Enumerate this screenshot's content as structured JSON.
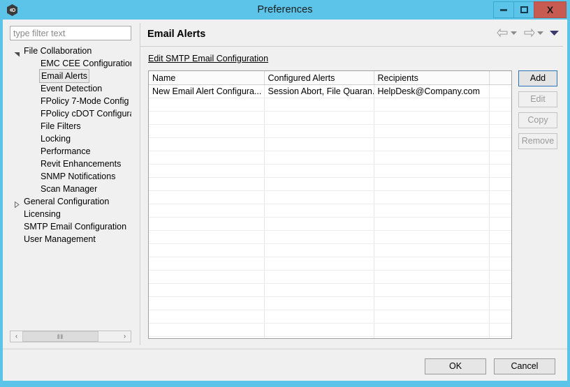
{
  "window": {
    "title": "Preferences",
    "app_icon": "app-hexagon-icon",
    "controls": {
      "minimize": "minimize-icon",
      "maximize": "maximize-icon",
      "close": "X"
    }
  },
  "sidebar": {
    "filter_placeholder": "type filter text",
    "items": [
      {
        "label": "File Collaboration",
        "level": 0,
        "state": "expanded",
        "selected": false
      },
      {
        "label": "EMC CEE Configuration",
        "level": 1,
        "state": "leaf",
        "selected": false
      },
      {
        "label": "Email Alerts",
        "level": 1,
        "state": "leaf",
        "selected": true
      },
      {
        "label": "Event Detection",
        "level": 1,
        "state": "leaf",
        "selected": false
      },
      {
        "label": "FPolicy 7-Mode Config",
        "level": 1,
        "state": "leaf",
        "selected": false
      },
      {
        "label": "FPolicy cDOT Configura",
        "level": 1,
        "state": "leaf",
        "selected": false
      },
      {
        "label": "File Filters",
        "level": 1,
        "state": "leaf",
        "selected": false
      },
      {
        "label": "Locking",
        "level": 1,
        "state": "leaf",
        "selected": false
      },
      {
        "label": "Performance",
        "level": 1,
        "state": "leaf",
        "selected": false
      },
      {
        "label": "Revit Enhancements",
        "level": 1,
        "state": "leaf",
        "selected": false
      },
      {
        "label": "SNMP Notifications",
        "level": 1,
        "state": "leaf",
        "selected": false
      },
      {
        "label": "Scan Manager",
        "level": 1,
        "state": "leaf",
        "selected": false
      },
      {
        "label": "General Configuration",
        "level": 0,
        "state": "collapsed",
        "selected": false
      },
      {
        "label": "Licensing",
        "level": 0,
        "state": "leaf",
        "selected": false
      },
      {
        "label": "SMTP Email Configuration",
        "level": 0,
        "state": "leaf",
        "selected": false
      },
      {
        "label": "User Management",
        "level": 0,
        "state": "leaf",
        "selected": false
      }
    ],
    "scrollbar": {
      "left_arrow": "‹",
      "right_arrow": "›",
      "thumb_grip": "‖‖"
    }
  },
  "content": {
    "title": "Email Alerts",
    "link": "Edit SMTP Email Configuration",
    "nav": {
      "back_icon": "back-arrow-icon",
      "back_menu_icon": "chevron-down-icon",
      "forward_icon": "forward-arrow-icon",
      "forward_menu_icon": "chevron-down-icon",
      "more_icon": "chevron-down-filled-icon"
    },
    "table": {
      "columns": [
        "Name",
        "Configured Alerts",
        "Recipients",
        ""
      ],
      "rows": [
        [
          "New Email Alert Configura...",
          "Session Abort, File Quaran...",
          "HelpDesk@Company.com",
          ""
        ]
      ],
      "empty_row_count": 21
    },
    "actions": [
      {
        "label": "Add",
        "enabled": true,
        "primary": true
      },
      {
        "label": "Edit",
        "enabled": false,
        "primary": false
      },
      {
        "label": "Copy",
        "enabled": false,
        "primary": false
      },
      {
        "label": "Remove",
        "enabled": false,
        "primary": false
      }
    ]
  },
  "footer": {
    "ok": "OK",
    "cancel": "Cancel"
  },
  "colors": {
    "window_frame": "#5bc4e8",
    "close_button": "#c75b51",
    "panel_bg": "#f0f0f0",
    "accent_border": "#2b74b8"
  }
}
